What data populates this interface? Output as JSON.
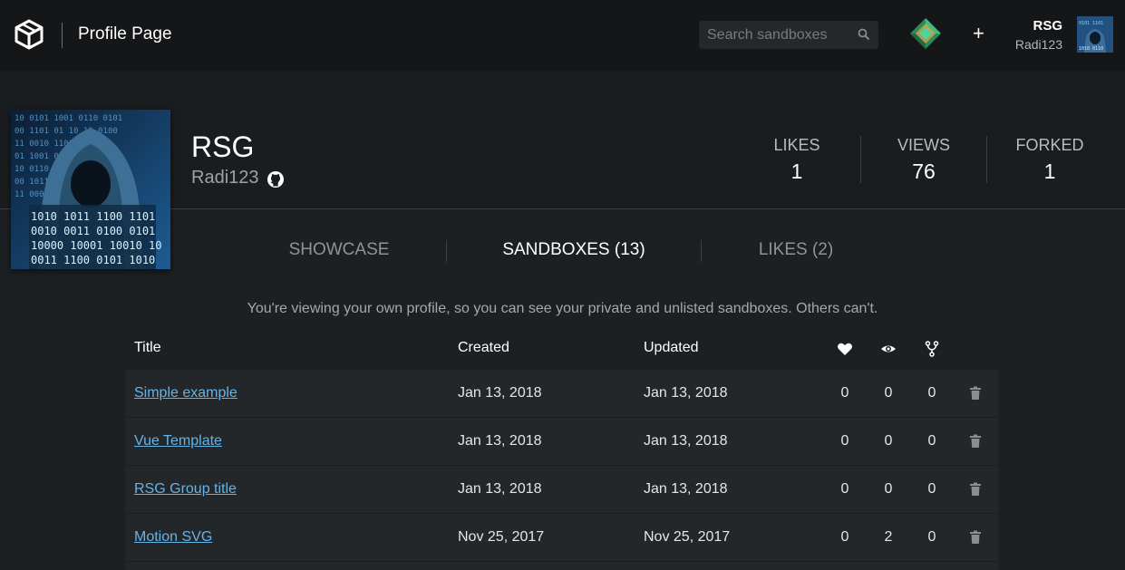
{
  "header": {
    "title": "Profile Page",
    "search_placeholder": "Search sandboxes",
    "user": {
      "name": "RSG",
      "handle": "Radi123"
    }
  },
  "profile": {
    "name": "RSG",
    "handle": "Radi123",
    "stats": [
      {
        "label": "LIKES",
        "value": "1"
      },
      {
        "label": "VIEWS",
        "value": "76"
      },
      {
        "label": "FORKED",
        "value": "1"
      }
    ]
  },
  "tabs": [
    {
      "label": "SHOWCASE",
      "active": false
    },
    {
      "label": "SANDBOXES (13)",
      "active": true
    },
    {
      "label": "LIKES (2)",
      "active": false
    }
  ],
  "notice": "You're viewing your own profile, so you can see your private and unlisted sandboxes. Others can't.",
  "table": {
    "columns": {
      "title": "Title",
      "created": "Created",
      "updated": "Updated",
      "likes_icon": "heart-icon",
      "views_icon": "eye-icon",
      "forks_icon": "fork-icon"
    },
    "rows": [
      {
        "title": "Simple example",
        "created": "Jan 13, 2018",
        "updated": "Jan 13, 2018",
        "likes": "0",
        "views": "0",
        "forks": "0"
      },
      {
        "title": "Vue Template",
        "created": "Jan 13, 2018",
        "updated": "Jan 13, 2018",
        "likes": "0",
        "views": "0",
        "forks": "0"
      },
      {
        "title": "RSG Group title",
        "created": "Jan 13, 2018",
        "updated": "Jan 13, 2018",
        "likes": "0",
        "views": "0",
        "forks": "0"
      },
      {
        "title": "Motion SVG",
        "created": "Nov 25, 2017",
        "updated": "Nov 25, 2017",
        "likes": "0",
        "views": "2",
        "forks": "0"
      }
    ]
  },
  "colors": {
    "link": "#66b3e8",
    "background": "#1c2022",
    "topbar": "#141618"
  }
}
